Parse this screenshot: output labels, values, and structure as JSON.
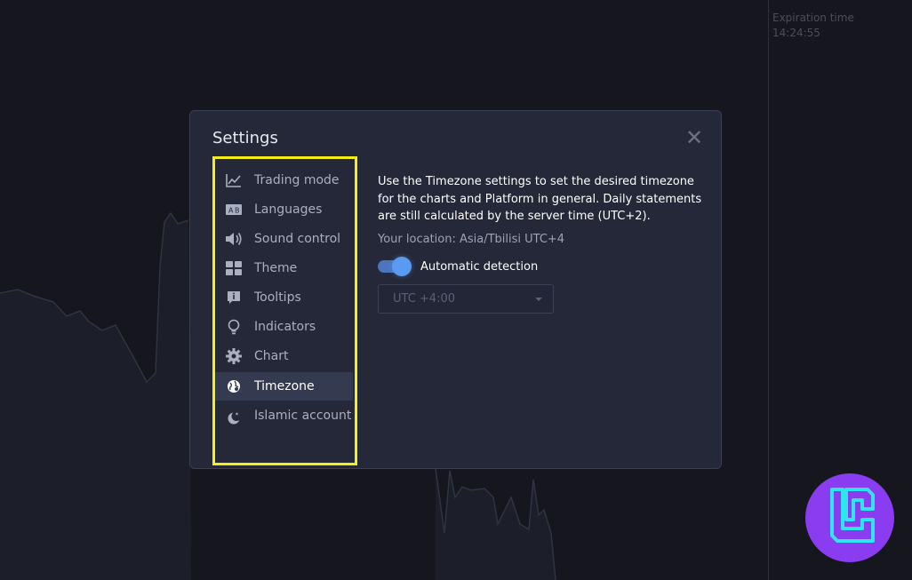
{
  "header": {
    "expiration_label": "Expiration time",
    "expiration_value": "14:24:55"
  },
  "dialog": {
    "title": "Settings",
    "close_label": "✕"
  },
  "sidebar": {
    "items": [
      {
        "label": "Trading mode",
        "icon": "chart-line-icon",
        "active": false
      },
      {
        "label": "Languages",
        "icon": "languages-icon",
        "active": false
      },
      {
        "label": "Sound control",
        "icon": "speaker-icon",
        "active": false
      },
      {
        "label": "Theme",
        "icon": "grid-icon",
        "active": false
      },
      {
        "label": "Tooltips",
        "icon": "info-bubble-icon",
        "active": false
      },
      {
        "label": "Indicators",
        "icon": "lightbulb-icon",
        "active": false
      },
      {
        "label": "Chart",
        "icon": "gear-icon",
        "active": false
      },
      {
        "label": "Timezone",
        "icon": "globe-icon",
        "active": true
      },
      {
        "label": "Islamic account",
        "icon": "crescent-icon",
        "active": false
      }
    ]
  },
  "timezone": {
    "description": "Use the Timezone settings to set the desired timezone for the charts and Platform in general. Daily statements are still calculated by the server time (UTC+2).",
    "location": "Your location: Asia/Tbilisi UTC+4",
    "auto_detection_label": "Automatic detection",
    "auto_detection_enabled": true,
    "select_value": "UTC +4:00"
  },
  "colors": {
    "accent": "#5a9af0",
    "highlight_frame": "#f5ef18",
    "dialog_bg": "#242838",
    "logo_bg": "#8a3cf0"
  }
}
